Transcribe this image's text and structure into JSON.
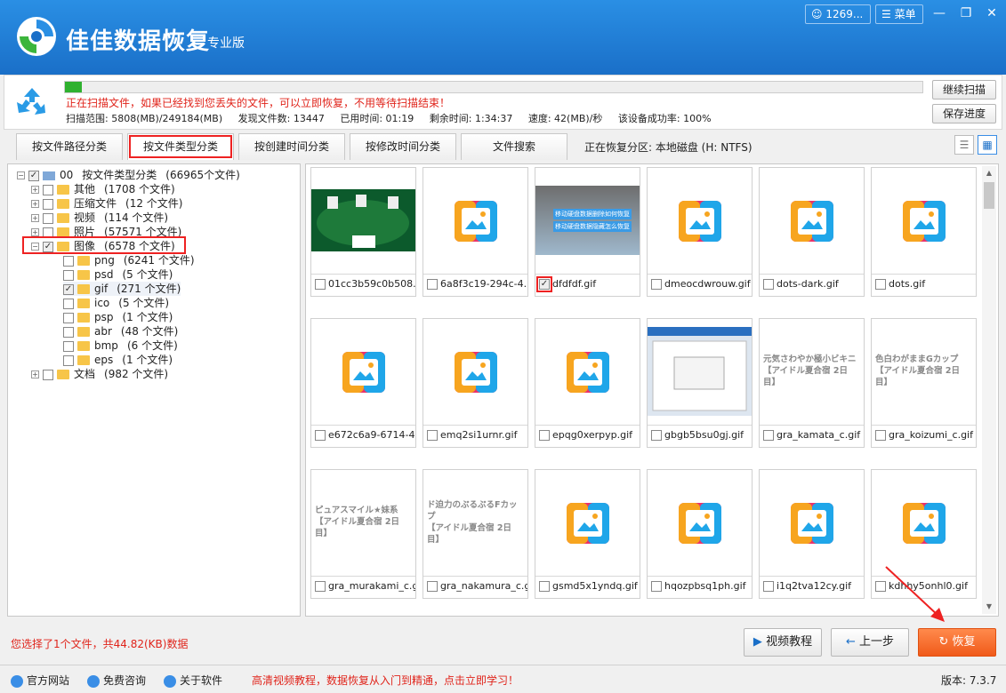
{
  "app": {
    "title": "佳佳数据恢复",
    "edition": "专业版",
    "user": "1269...",
    "menu": "菜单"
  },
  "scan": {
    "progress_percent": 2,
    "message": "正在扫描文件，如果已经找到您丢失的文件，可以立即恢复，不用等待扫描结束！",
    "range": "扫描范围: 5808(MB)/249184(MB)",
    "found": "发现文件数: 13447",
    "elapsed": "已用时间: 01:19",
    "remaining": "剩余时间: 1:34:37",
    "speed": "速度: 42(MB)/秒",
    "success_rate": "该设备成功率: 100%",
    "continue_label": "继续扫描",
    "save_label": "保存进度"
  },
  "tabs": [
    {
      "label": "按文件路径分类"
    },
    {
      "label": "按文件类型分类"
    },
    {
      "label": "按创建时间分类"
    },
    {
      "label": "按修改时间分类"
    },
    {
      "label": "文件搜索"
    }
  ],
  "partition": "正在恢复分区: 本地磁盘 (H: NTFS)",
  "tree": {
    "root": {
      "code": "00",
      "label": "按文件类型分类",
      "count": "(66965个文件)"
    },
    "categories": [
      {
        "label": "其他",
        "count": "(1708 个文件)"
      },
      {
        "label": "压缩文件",
        "count": "(12 个文件)"
      },
      {
        "label": "视频",
        "count": "(114 个文件)"
      },
      {
        "label": "照片",
        "count": "(57571 个文件)"
      },
      {
        "label": "图像",
        "count": "(6578 个文件)"
      }
    ],
    "image_types": [
      {
        "label": "png",
        "count": "(6241 个文件)"
      },
      {
        "label": "psd",
        "count": "(5 个文件)"
      },
      {
        "label": "gif",
        "count": "(271 个文件)"
      },
      {
        "label": "ico",
        "count": "(5 个文件)"
      },
      {
        "label": "psp",
        "count": "(1 个文件)"
      },
      {
        "label": "abr",
        "count": "(48 个文件)"
      },
      {
        "label": "bmp",
        "count": "(6 个文件)"
      },
      {
        "label": "eps",
        "count": "(1 个文件)"
      }
    ],
    "documents": {
      "label": "文档",
      "count": "(982 个文件)"
    }
  },
  "files": [
    {
      "name": "01cc3b59c0b508..."
    },
    {
      "name": "6a8f3c19-294c-4..."
    },
    {
      "name": "dfdfdf.gif",
      "banner1": "移动硬盘数据删除如何恢复",
      "banner2": "移动硬盘数据隐藏怎么恢复"
    },
    {
      "name": "dmeocdwrouw.gif"
    },
    {
      "name": "dots-dark.gif"
    },
    {
      "name": "dots.gif"
    },
    {
      "name": "e672c6a9-6714-4..."
    },
    {
      "name": "emq2si1urnr.gif"
    },
    {
      "name": "epqg0xerpyp.gif"
    },
    {
      "name": "gbgb5bsu0gj.gif"
    },
    {
      "name": "gra_kamata_c.gif",
      "line1": "元気さわやか極小ビキニ",
      "line2": "【アイドル夏合宿 2日目】"
    },
    {
      "name": "gra_koizumi_c.gif",
      "line1": "色白わがままGカップ",
      "line2": "【アイドル夏合宿 2日目】"
    },
    {
      "name": "gra_murakami_c.gif",
      "line1": "ピュアスマイル★妹系",
      "line2": "【アイドル夏合宿 2日目】"
    },
    {
      "name": "gra_nakamura_c.gif",
      "line1": "ド迫力のぷるぷるFカップ",
      "line2": "【アイドル夏合宿 2日目】"
    },
    {
      "name": "gsmd5x1yndq.gif"
    },
    {
      "name": "hqozpbsq1ph.gif"
    },
    {
      "name": "i1q2tva12cy.gif"
    },
    {
      "name": "kdhhy5onhl0.gif"
    }
  ],
  "bottom": {
    "selected_info": "您选择了1个文件，共44.82(KB)数据",
    "video_tutorial": "视频教程",
    "prev": "上一步",
    "recover": "恢复"
  },
  "status": {
    "official_site": "官方网站",
    "consult": "免费咨询",
    "about": "关于软件",
    "promo": "高清视频教程，数据恢复从入门到精通，点击立即学习！",
    "version": "版本: 7.3.7"
  },
  "colors": {
    "accent": "#1a6fc8",
    "alert": "#e0241b",
    "recover": "#f05a1a"
  }
}
